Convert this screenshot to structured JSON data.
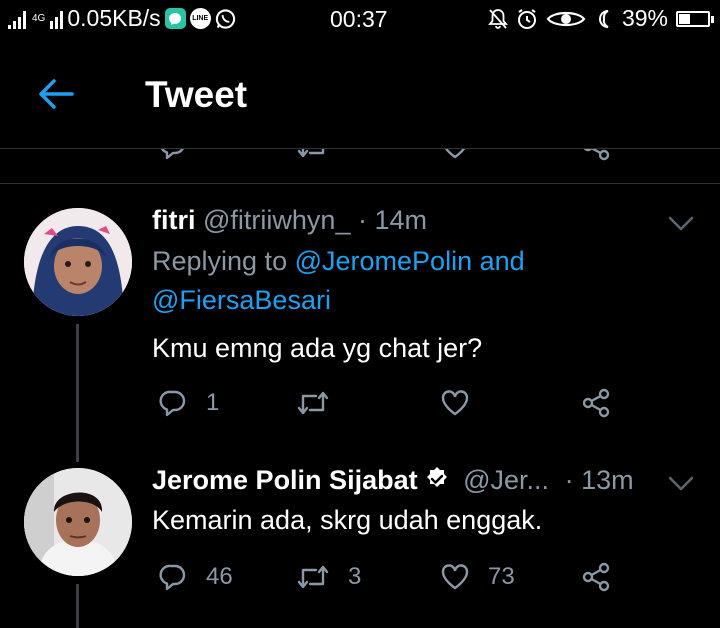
{
  "status_bar": {
    "network_type": "4G",
    "speed": "0.05KB/s",
    "time": "00:37",
    "battery": "39%",
    "battery_level": 0.39,
    "app_icons": [
      "messenger-icon",
      "line-icon",
      "whatsapp-icon"
    ],
    "line_label": "LINE"
  },
  "header": {
    "title": "Tweet",
    "back_icon": "arrow-left-icon"
  },
  "tweets": [
    {
      "name": "fitri",
      "handle": "@fitriiwhyn_",
      "dot": "·",
      "time": "14m",
      "replying_label": "Replying to",
      "reply_to_1": "@JeromePolin",
      "and_label": "and",
      "reply_to_2": "@FiersaBesari",
      "text": "Kmu emng ada yg chat jer?",
      "replies": "1",
      "retweets": "",
      "likes": ""
    },
    {
      "name": "Jerome Polin Sijabat",
      "handle": "@Jer...",
      "dot": "·",
      "time": "13m",
      "verified": true,
      "text": "Kemarin ada, skrg udah enggak.",
      "replies": "46",
      "retweets": "3",
      "likes": "73"
    }
  ],
  "colors": {
    "background": "#000000",
    "accent": "#1da1f2",
    "muted": "#8b98a5",
    "divider": "#2f3336"
  }
}
